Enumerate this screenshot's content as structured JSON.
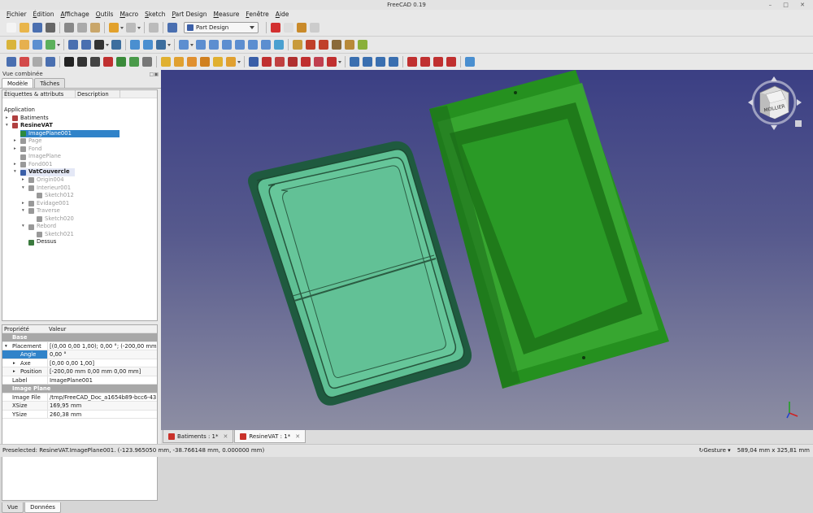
{
  "window": {
    "title": "FreeCAD 0.19",
    "controls": "– □ ✕"
  },
  "menu": [
    "Fichier",
    "Édition",
    "Affichage",
    "Outils",
    "Macro",
    "Sketch",
    "Part Design",
    "Measure",
    "Fenêtre",
    "Aide"
  ],
  "toolbar": {
    "workbench": "Part Design"
  },
  "combo": {
    "title": "Vue combinée",
    "tabs": [
      "Modèle",
      "Tâches"
    ],
    "tree_headers": [
      "Étiquettes & attributs",
      "Description"
    ],
    "tree": [
      {
        "label": "Application",
        "depth": 0,
        "exp": "",
        "style": "",
        "color": ""
      },
      {
        "label": "Batiments",
        "depth": 1,
        "exp": "▸",
        "style": "",
        "color": "#b04040"
      },
      {
        "label": "ResineVAT",
        "depth": 1,
        "exp": "▾",
        "style": "bold",
        "color": "#b04040"
      },
      {
        "label": "ImagePlane001",
        "depth": 2,
        "exp": "",
        "style": "sel",
        "color": "#2d8a3e"
      },
      {
        "label": "Page",
        "depth": 2,
        "exp": "▸",
        "style": "faded",
        "color": "#999"
      },
      {
        "label": "Fond",
        "depth": 2,
        "exp": "▸",
        "style": "faded",
        "color": "#999"
      },
      {
        "label": "ImagePlane",
        "depth": 2,
        "exp": "",
        "style": "faded",
        "color": "#999"
      },
      {
        "label": "Fond001",
        "depth": 2,
        "exp": "▸",
        "style": "faded",
        "color": "#999"
      },
      {
        "label": "VatCouvercle",
        "depth": 2,
        "exp": "▾",
        "style": "bold boxed",
        "color": "#3b5fa8"
      },
      {
        "label": "Origin004",
        "depth": 3,
        "exp": "▸",
        "style": "faded",
        "color": "#999"
      },
      {
        "label": "Interieur001",
        "depth": 3,
        "exp": "▾",
        "style": "faded",
        "color": "#999"
      },
      {
        "label": "Sketch012",
        "depth": 4,
        "exp": "",
        "style": "faded",
        "color": "#999"
      },
      {
        "label": "Evidage001",
        "depth": 3,
        "exp": "▸",
        "style": "faded",
        "color": "#999"
      },
      {
        "label": "Traverse",
        "depth": 3,
        "exp": "▾",
        "style": "faded",
        "color": "#999"
      },
      {
        "label": "Sketch020",
        "depth": 4,
        "exp": "",
        "style": "faded",
        "color": "#999"
      },
      {
        "label": "Rebord",
        "depth": 3,
        "exp": "▾",
        "style": "faded",
        "color": "#999"
      },
      {
        "label": "Sketch021",
        "depth": 4,
        "exp": "",
        "style": "faded",
        "color": "#999"
      },
      {
        "label": "Dessus",
        "depth": 3,
        "exp": "",
        "style": "",
        "color": "#3b7a3e"
      }
    ],
    "prop_headers": [
      "Propriété",
      "Valeur"
    ],
    "props": [
      {
        "name": "Base",
        "value": "",
        "kind": "group"
      },
      {
        "name": "Placement",
        "value": "[(0,00 0,00 1,00); 0,00 °; (-200,00 mm …",
        "kind": "exp"
      },
      {
        "name": "Angle",
        "value": "0,00 °",
        "kind": "selsub"
      },
      {
        "name": "Axe",
        "value": "[0,00 0,00 1,00]",
        "kind": "subexp"
      },
      {
        "name": "Position",
        "value": "[-200,00 mm  0,00 mm  0,00 mm]",
        "kind": "subexp"
      },
      {
        "name": "Label",
        "value": "ImagePlane001",
        "kind": ""
      },
      {
        "name": "Image Plane",
        "value": "",
        "kind": "group"
      },
      {
        "name": "Image File",
        "value": "/tmp/FreeCAD_Doc_a1654b89-bcc6-43…",
        "kind": ""
      },
      {
        "name": "XSize",
        "value": "169,95 mm",
        "kind": ""
      },
      {
        "name": "YSize",
        "value": "260,38 mm",
        "kind": ""
      }
    ],
    "bottom_tabs": [
      "Vue",
      "Données"
    ]
  },
  "doc_tabs": [
    {
      "label": "Batiments : 1*",
      "active": false
    },
    {
      "label": "ResineVAT : 1*",
      "active": true
    }
  ],
  "navcube": {
    "face_label": "MOLLIER"
  },
  "status": {
    "message": "Preselected: ResineVAT.ImagePlane001. (-123.965050 mm, -38.766148 mm, 0.000000 mm)",
    "nav_style": "Gesture",
    "dimensions": "589,04 mm x 325,81 mm"
  },
  "colors": {
    "model_green": "#5fc094",
    "image_green": "#2fa12f",
    "selection": "#3083c9"
  }
}
